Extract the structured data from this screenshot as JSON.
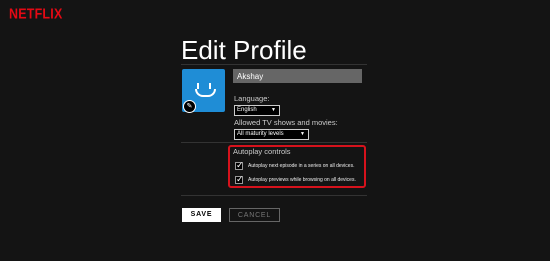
{
  "header": {
    "logo": "NETFLIX"
  },
  "page": {
    "title": "Edit Profile"
  },
  "profile": {
    "name_value": "Akshay",
    "avatar_icon": "smiley-face-icon",
    "avatar_color": "#1f8dd6",
    "edit_icon": "pencil-icon"
  },
  "language": {
    "label": "Language:",
    "selected": "English"
  },
  "maturity": {
    "label": "Allowed TV shows and movies:",
    "selected": "All maturity levels"
  },
  "autoplay": {
    "title": "Autoplay controls",
    "options": [
      {
        "label": "Autoplay next episode in a series on all devices.",
        "checked": true
      },
      {
        "label": "Autoplay previews while browsing on all devices.",
        "checked": true
      }
    ]
  },
  "buttons": {
    "save": "SAVE",
    "cancel": "CANCEL"
  },
  "colors": {
    "brand": "#e50914",
    "highlight": "#d6121c",
    "background": "#141414"
  }
}
